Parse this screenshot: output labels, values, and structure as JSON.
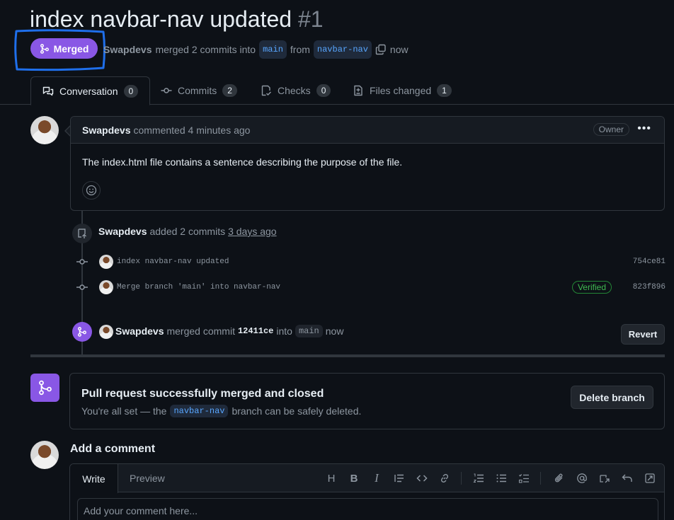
{
  "pr": {
    "title": "index navbar-nav updated",
    "number": "#1",
    "status_badge": "Merged",
    "author": "Swapdevs",
    "meta_text": "merged 2 commits into",
    "base_branch": "main",
    "from_text": "from",
    "head_branch": "navbar-nav",
    "time": "now"
  },
  "tabs": [
    {
      "label": "Conversation",
      "count": "0",
      "icon": "comment-discussion-icon"
    },
    {
      "label": "Commits",
      "count": "2",
      "icon": "commit-icon"
    },
    {
      "label": "Checks",
      "count": "0",
      "icon": "checklist-icon"
    },
    {
      "label": "Files changed",
      "count": "1",
      "icon": "file-diff-icon"
    }
  ],
  "comment": {
    "author": "Swapdevs",
    "action": "commented 4 minutes ago",
    "badge": "Owner",
    "menu": "•••",
    "body": "The index.html file contains a sentence describing the purpose of the file."
  },
  "commits_event": {
    "author": "Swapdevs",
    "action": "added 2 commits",
    "time": "3 days ago",
    "commits": [
      {
        "message": "index navbar-nav updated",
        "sha": "754ce81",
        "verified": ""
      },
      {
        "message": "Merge branch 'main' into navbar-nav",
        "sha": "823f896",
        "verified": "Verified"
      }
    ]
  },
  "merge_event": {
    "author": "Swapdevs",
    "action": "merged commit",
    "commit": "12411ce",
    "into": "into",
    "branch": "main",
    "time": "now",
    "revert_label": "Revert"
  },
  "merge_box": {
    "title": "Pull request successfully merged and closed",
    "desc_before": "You're all set — the",
    "branch": "navbar-nav",
    "desc_after": "branch can be safely deleted.",
    "delete_label": "Delete branch"
  },
  "add_comment": {
    "heading": "Add a comment",
    "write_tab": "Write",
    "preview_tab": "Preview",
    "placeholder": "Add your comment here...",
    "toolbar": [
      "heading-icon",
      "bold-icon",
      "italic-icon",
      "quote-icon",
      "code-icon",
      "link-icon",
      "ordered-list-icon",
      "unordered-list-icon",
      "task-list-icon",
      "attach-icon",
      "mention-icon",
      "reference-icon",
      "undo-icon",
      "fullscreen-icon"
    ]
  },
  "colors": {
    "merged_purple": "#8957e5",
    "annotation_blue": "#1f6feb",
    "bg": "#0d1117"
  }
}
